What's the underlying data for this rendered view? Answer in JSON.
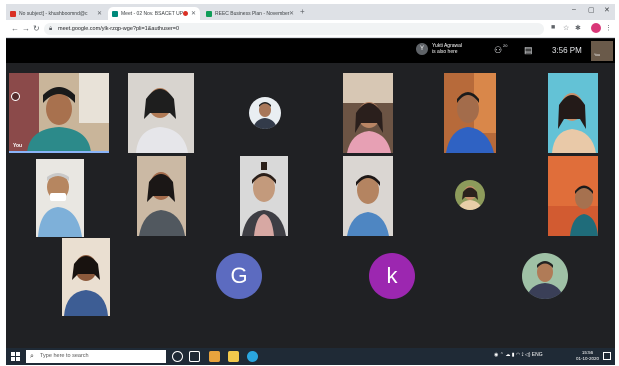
{
  "browser": {
    "tabs": [
      {
        "label": "No subject] - khushboomnd@c",
        "favicon_color": "#d93025"
      },
      {
        "label": "Meet - 02 Nov. BSACET UP",
        "favicon_color": "#00897b"
      },
      {
        "label": "REEC Business Plan - November",
        "favicon_color": "#0f9d58"
      }
    ],
    "new_tab": "+",
    "url": "meet.google.com/ylk-rzqp-wge?pli=1&authuser=0",
    "window_controls": {
      "minimize": "–",
      "maximize": "▢",
      "close": "✕"
    }
  },
  "meet": {
    "notice_avatar": "Y",
    "notice_line1": "Yukti Agrawal",
    "notice_line2": "is also here",
    "people_count": "20",
    "time": "3:56 PM",
    "self_label": "You",
    "you_label": "You",
    "participants": [
      {
        "id": "p1",
        "letter": "G",
        "color": "#5c6bc0"
      },
      {
        "id": "p2",
        "letter": "k",
        "color": "#9c27b0"
      }
    ]
  },
  "taskbar": {
    "search_placeholder": "Type here to search",
    "tray_text": "ENG",
    "time": "15:56",
    "date": "01-10-2020"
  }
}
